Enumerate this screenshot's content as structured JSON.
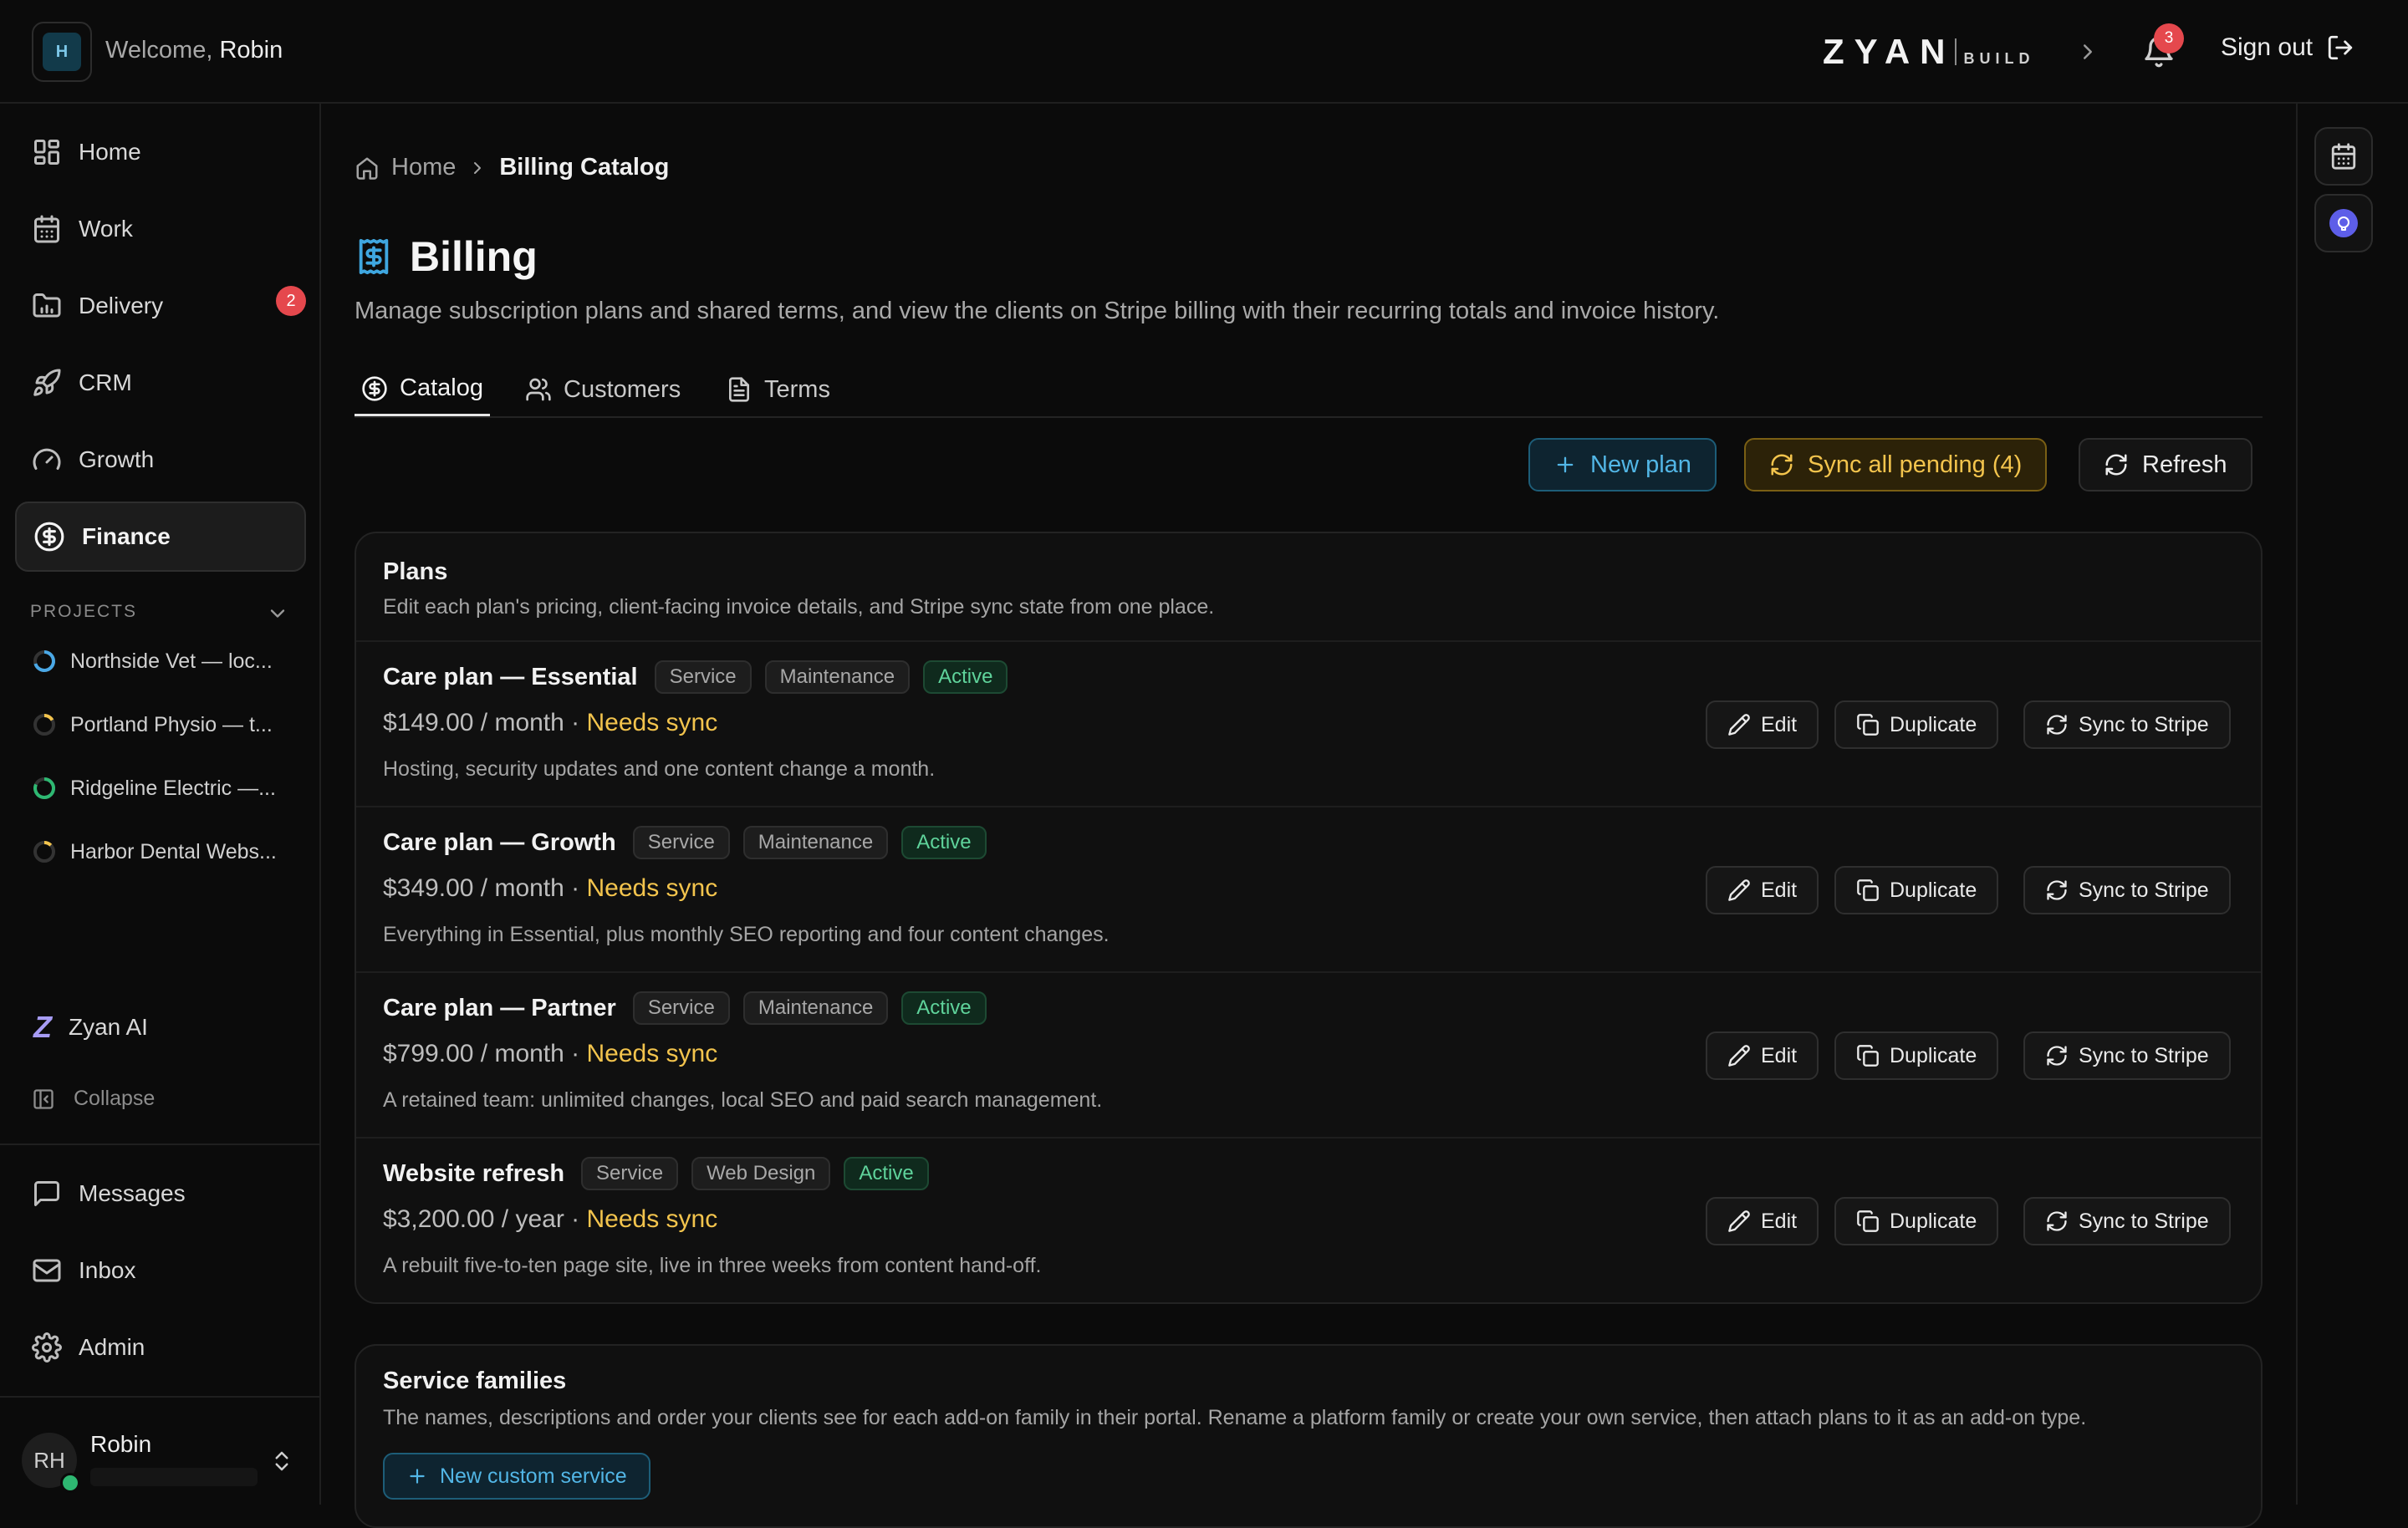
{
  "topbar": {
    "org_initial": "H",
    "welcome_prefix": "Welcome,",
    "user_first_name": "Robin",
    "brand_main": "ZYAN",
    "brand_sub": "BUILD",
    "notification_count": "3",
    "sign_out_label": "Sign out"
  },
  "sidebar": {
    "nav": [
      {
        "label": "Home",
        "icon": "dashboard-icon"
      },
      {
        "label": "Work",
        "icon": "calendar-icon"
      },
      {
        "label": "Delivery",
        "icon": "folder-chart-icon",
        "badge": "2"
      },
      {
        "label": "CRM",
        "icon": "rocket-icon"
      },
      {
        "label": "Growth",
        "icon": "gauge-icon"
      },
      {
        "label": "Finance",
        "icon": "dollar-circle-icon",
        "active": true
      }
    ],
    "projects_header": "PROJECTS",
    "projects": [
      {
        "label": "Northside Vet — loc...",
        "color": "#4aa8e6"
      },
      {
        "label": "Portland Physio — t...",
        "color": "#f3c44d"
      },
      {
        "label": "Ridgeline Electric —...",
        "color": "#2eb872"
      },
      {
        "label": "Harbor Dental Webs...",
        "color": "#f3c44d"
      }
    ],
    "ai_label": "Zyan AI",
    "collapse_label": "Collapse",
    "bottom_nav": [
      {
        "label": "Messages",
        "icon": "message-icon"
      },
      {
        "label": "Inbox",
        "icon": "mail-icon"
      },
      {
        "label": "Admin",
        "icon": "gear-icon"
      }
    ],
    "user": {
      "initials": "RH",
      "name": "Robin"
    }
  },
  "breadcrumb": {
    "home": "Home",
    "current": "Billing Catalog"
  },
  "page": {
    "title": "Billing",
    "subtitle": "Manage subscription plans and shared terms, and view the clients on Stripe billing with their recurring totals and invoice history."
  },
  "tabs": [
    {
      "label": "Catalog",
      "active": true
    },
    {
      "label": "Customers"
    },
    {
      "label": "Terms"
    }
  ],
  "actions": {
    "new_plan": "New plan",
    "sync_pending": "Sync all pending (4)",
    "refresh": "Refresh"
  },
  "plans_card": {
    "title": "Plans",
    "description": "Edit each plan's pricing, client-facing invoice details, and Stripe sync state from one place.",
    "edit_label": "Edit",
    "duplicate_label": "Duplicate",
    "sync_label": "Sync to Stripe",
    "plans": [
      {
        "name": "Care plan — Essential",
        "tags": [
          "Service",
          "Maintenance"
        ],
        "status": "Active",
        "price": "$149.00 / month ·",
        "sync_state": "Needs sync",
        "description": "Hosting, security updates and one content change a month."
      },
      {
        "name": "Care plan — Growth",
        "tags": [
          "Service",
          "Maintenance"
        ],
        "status": "Active",
        "price": "$349.00 / month ·",
        "sync_state": "Needs sync",
        "description": "Everything in Essential, plus monthly SEO reporting and four content changes."
      },
      {
        "name": "Care plan — Partner",
        "tags": [
          "Service",
          "Maintenance"
        ],
        "status": "Active",
        "price": "$799.00 / month ·",
        "sync_state": "Needs sync",
        "description": "A retained team: unlimited changes, local SEO and paid search management."
      },
      {
        "name": "Website refresh",
        "tags": [
          "Service",
          "Web Design"
        ],
        "status": "Active",
        "price": "$3,200.00 / year ·",
        "sync_state": "Needs sync",
        "description": "A rebuilt five-to-ten page site, live in three weeks from content hand-off."
      }
    ]
  },
  "families_card": {
    "title": "Service families",
    "description": "The names, descriptions and order your clients see for each add-on family in their portal. Rename a platform family or create your own service, then attach plans to it as an add-on type.",
    "new_custom_label": "New custom service"
  },
  "colors": {
    "accent_blue": "#52b6e6",
    "warn_yellow": "#f3c44d",
    "success_green": "#5fd39b",
    "badge_red": "#e5484d"
  }
}
